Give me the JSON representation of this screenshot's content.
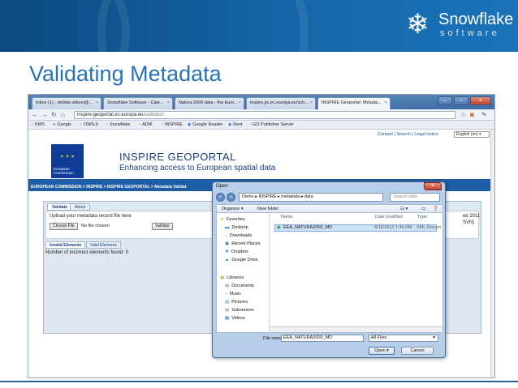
{
  "slide": {
    "title": "Validating Metadata",
    "logo": {
      "word1": "Snowflake",
      "word2": "software"
    }
  },
  "browser": {
    "tabs": [
      {
        "label": "Inbox (1) - debbie.wilson@..."
      },
      {
        "label": "Snowflake Software - Cale..."
      },
      {
        "label": "Natura 2000 data - the Euro..."
      },
      {
        "label": "inspire.jrc.ec.europa.eu/sch..."
      },
      {
        "label": "INSPIRE Geoportal: Metada..."
      }
    ],
    "address": {
      "host": "inspire-geoportal.ec.europa.eu",
      "path": "/validator/"
    },
    "bookmarks": [
      "KMS",
      "Google",
      "OWS-9",
      "Snowflake",
      "ADM",
      "INSPIRE",
      "Google Reader",
      "Next",
      "GO Publisher Server"
    ]
  },
  "page": {
    "toplinks": "Contact | Search | Legal notice",
    "language": "English (en)",
    "eu_label": "European Commission",
    "title": "INSPIRE GEOPORTAL",
    "subtitle": "Enhancing access to European spatial data",
    "breadcrumb": "EUROPEAN COMMISSION > INSPIRE > INSPIRE GEOPORTAL > Metadata Validat",
    "tabs": [
      "Validate",
      "About"
    ],
    "upload_label": "Upload your metadata record file here",
    "choose_file": "Choose File",
    "no_file": "No file chosen",
    "validate_button": "Validate",
    "right_text": [
      "eb 2011",
      "SVN)"
    ],
    "result_tabs": [
      "Invalid Elements",
      "Valid Elements"
    ],
    "incorrect_count": "Number of incorrect elements found: 0"
  },
  "dialog": {
    "title": "Open",
    "path": "Demo ▸ INSPIRE ▸ metadata ▸ data",
    "search_placeholder": "Search data",
    "organize": "Organize ▾",
    "new_folder": "New folder",
    "nav": {
      "favorites": "Favorites",
      "favorites_items": [
        "Desktop",
        "Downloads",
        "Recent Places",
        "Dropbox",
        "Google Drive"
      ],
      "libraries": "Libraries",
      "library_items": [
        "Documents",
        "Music",
        "Pictures",
        "Subversion",
        "Videos"
      ]
    },
    "columns": [
      "Name",
      "Date modified",
      "Type"
    ],
    "file": {
      "name": "EEA_NATURA2000_MD",
      "date": "8/16/2012 1:46 PM",
      "type": "XML Docum"
    },
    "file_name_label": "File name:",
    "file_name_value": "EEA_NATURA2000_MD",
    "file_type": "All Files",
    "open_button": "Open",
    "cancel_button": "Cancel"
  }
}
